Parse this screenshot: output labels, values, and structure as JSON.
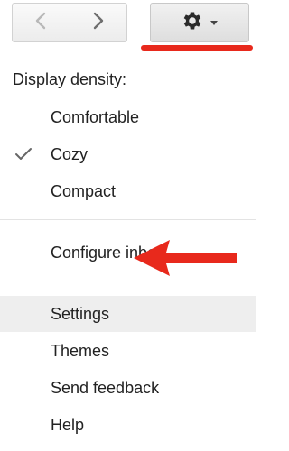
{
  "toolbar": {
    "prev_icon": "chevron-left-icon",
    "next_icon": "chevron-right-icon",
    "settings_icon": "gear-icon",
    "dropdown_icon": "caret-down-icon"
  },
  "menu": {
    "section_label": "Display density:",
    "density_options": [
      {
        "label": "Comfortable",
        "checked": false
      },
      {
        "label": "Cozy",
        "checked": true
      },
      {
        "label": "Compact",
        "checked": false
      }
    ],
    "configure_inbox": "Configure inbox",
    "items": [
      {
        "label": "Settings",
        "highlighted": true
      },
      {
        "label": "Themes",
        "highlighted": false
      },
      {
        "label": "Send feedback",
        "highlighted": false
      },
      {
        "label": "Help",
        "highlighted": false
      }
    ]
  },
  "colors": {
    "annotation_red": "#e8291c",
    "highlight_bg": "#eeeeee",
    "divider": "#e3e3e3",
    "icon_gray": "#8a8a8a",
    "gear": "#2a2a2a"
  }
}
